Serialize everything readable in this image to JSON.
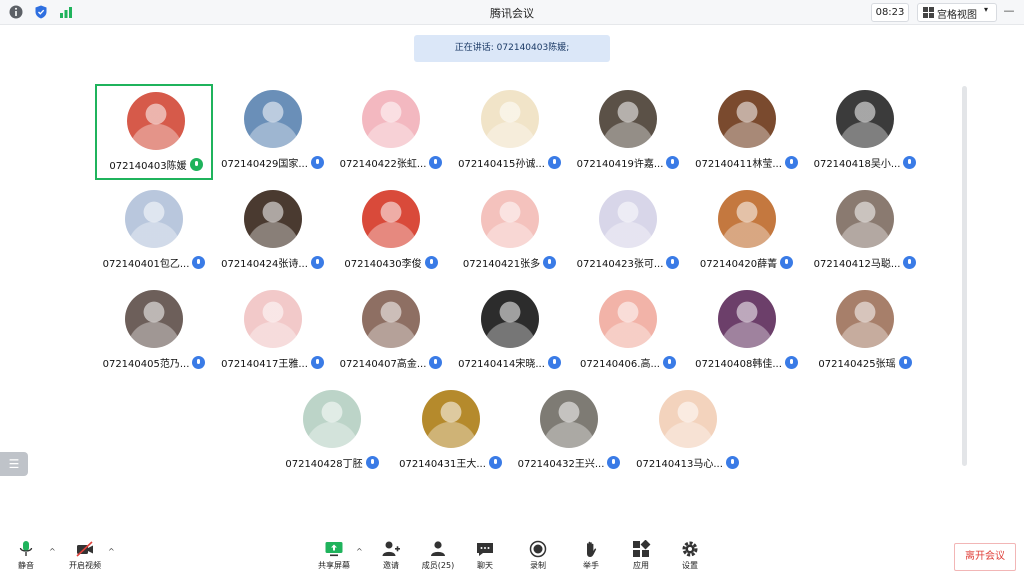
{
  "titlebar": {
    "title": "腾讯会议",
    "time": "08:23",
    "view_label": "宫格视图",
    "icons": [
      "info-icon",
      "shield-icon",
      "signal-icon"
    ]
  },
  "speaking_banner": "正在讲话: 072140403陈媛;",
  "participants": [
    {
      "name": "072140403陈媛",
      "mic": "active",
      "avatar_color": "#d65a4a",
      "active": true
    },
    {
      "name": "072140429国家...",
      "mic": "on",
      "avatar_color": "#6a8fb8"
    },
    {
      "name": "072140422张虹...",
      "mic": "on",
      "avatar_color": "#f3b8c0"
    },
    {
      "name": "072140415孙诚...",
      "mic": "on",
      "avatar_color": "#f1e4c8"
    },
    {
      "name": "072140419许嘉...",
      "mic": "on",
      "avatar_color": "#5b5147"
    },
    {
      "name": "072140411林莹...",
      "mic": "on",
      "avatar_color": "#7a4a2e"
    },
    {
      "name": "072140418吴小...",
      "mic": "on",
      "avatar_color": "#3b3b3b"
    },
    {
      "name": "072140401包乙...",
      "mic": "on",
      "avatar_color": "#b9c7dd"
    },
    {
      "name": "072140424张诗...",
      "mic": "on",
      "avatar_color": "#4a3a30"
    },
    {
      "name": "072140430李俊",
      "mic": "on",
      "avatar_color": "#d94a3a"
    },
    {
      "name": "072140421张多",
      "mic": "on",
      "avatar_color": "#f4c2bd"
    },
    {
      "name": "072140423张可...",
      "mic": "on",
      "avatar_color": "#d8d6e9"
    },
    {
      "name": "072140420薛菁",
      "mic": "on",
      "avatar_color": "#c4783f"
    },
    {
      "name": "072140412马聪...",
      "mic": "on",
      "avatar_color": "#8a7a70"
    },
    {
      "name": "072140405范乃...",
      "mic": "on",
      "avatar_color": "#6d5f5a"
    },
    {
      "name": "072140417王雅...",
      "mic": "on",
      "avatar_color": "#f2c9c9"
    },
    {
      "name": "072140407高金...",
      "mic": "on",
      "avatar_color": "#8e6f63"
    },
    {
      "name": "072140414宋晓...",
      "mic": "on",
      "avatar_color": "#2c2c2c"
    },
    {
      "name": "072140406.高...",
      "mic": "on",
      "avatar_color": "#f2b3a8"
    },
    {
      "name": "072140408韩佳...",
      "mic": "on",
      "avatar_color": "#6c3f6a"
    },
    {
      "name": "072140425张瑶",
      "mic": "on",
      "avatar_color": "#a77f6a"
    },
    {
      "name": "072140428丁胚",
      "mic": "on",
      "avatar_color": "#bcd4c8"
    },
    {
      "name": "072140431王大...",
      "mic": "on",
      "avatar_color": "#b58a2c"
    },
    {
      "name": "072140432王兴...",
      "mic": "on",
      "avatar_color": "#7e7b74"
    },
    {
      "name": "072140413马心...",
      "mic": "on",
      "avatar_color": "#f3d3bd"
    }
  ],
  "toolbar": {
    "mute": "静音",
    "video": "开启视频",
    "share": "共享屏幕",
    "invite": "邀请",
    "members": "成员(25)",
    "chat": "聊天",
    "record": "录制",
    "raise_hand": "举手",
    "apps": "应用",
    "settings": "设置",
    "leave": "离开会议"
  },
  "colors": {
    "accent": "#1fb35c",
    "mic_blue": "#3a7be6",
    "leave_red": "#e0413b",
    "banner": "#dbe7f8"
  }
}
